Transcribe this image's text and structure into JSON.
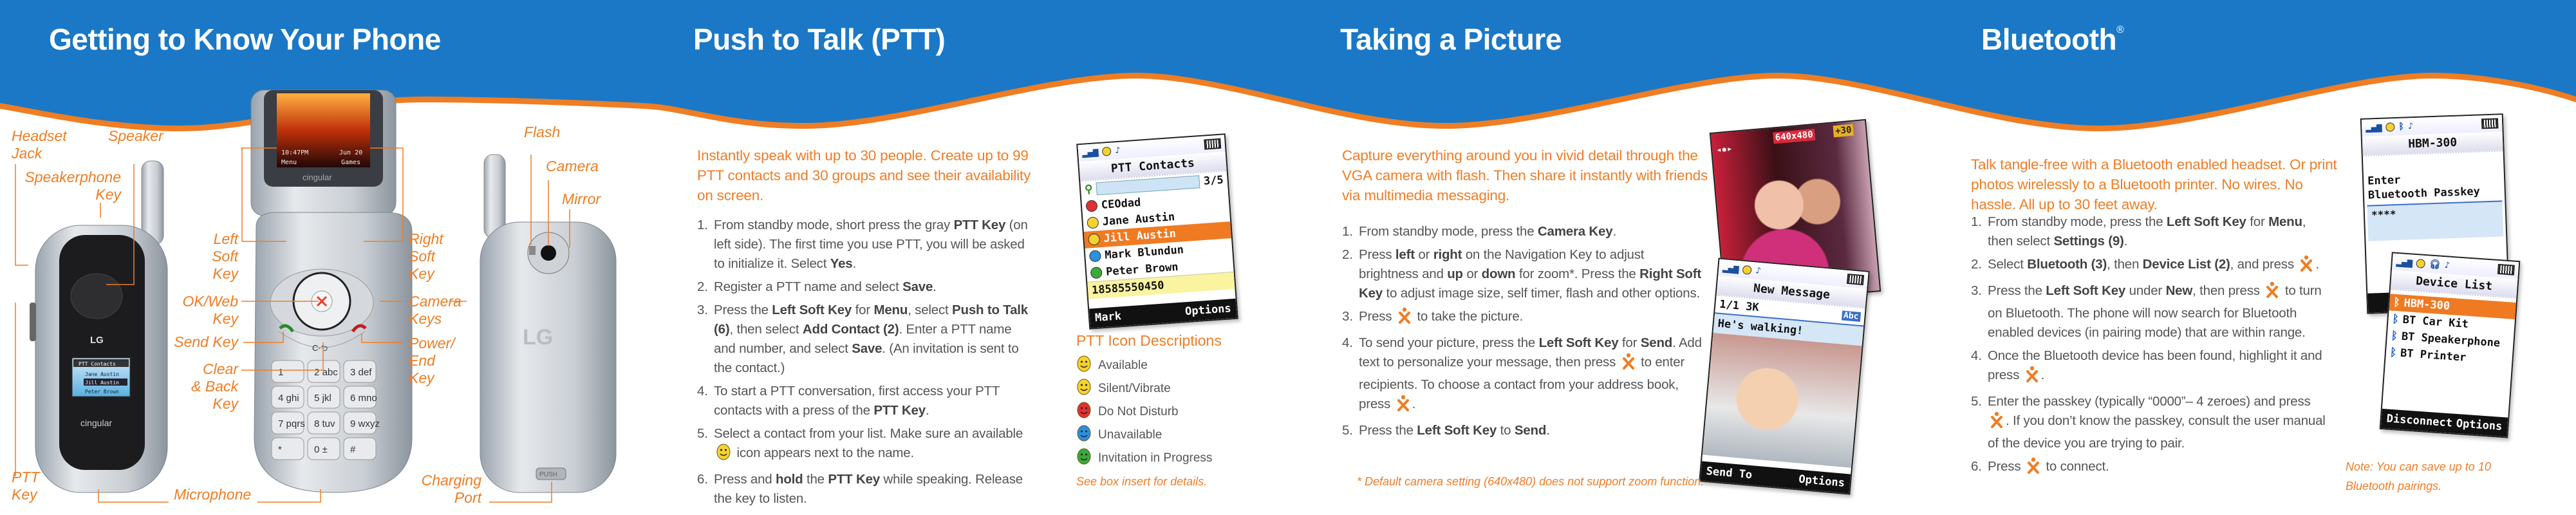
{
  "colors": {
    "header_blue": "#1a78c6",
    "accent_orange": "#ef7d23",
    "text_gray": "#555555"
  },
  "sections": {
    "phone": {
      "title": "Getting to Know Your Phone"
    },
    "ptt": {
      "title": "Push to Talk (PTT)"
    },
    "camera": {
      "title": "Taking a Picture"
    },
    "bluetooth": {
      "title": "Bluetooth",
      "title_mark": "®"
    }
  },
  "phone_labels": {
    "headset_jack": "Headset\nJack",
    "speaker": "Speaker",
    "speakerphone_key": "Speakerphone\nKey",
    "left_soft_key": "Left\nSoft\nKey",
    "ok_web_key": "OK/Web\nKey",
    "send_key": "Send Key",
    "clear_back_key": "Clear\n& Back\nKey",
    "ptt_key": "PTT\nKey",
    "microphone": "Microphone",
    "right_soft_key": "Right\nSoft\nKey",
    "camera_keys": "Camera\nKeys",
    "power_end_key": "Power/\nEnd\nKey",
    "flash": "Flash",
    "camera": "Camera",
    "mirror": "Mirror",
    "charging_port": "Charging\nPort"
  },
  "phone_images": {
    "brand": "cingular",
    "logo": "LG",
    "push_label": "PUSH",
    "open_screen": {
      "time": "10:47PM",
      "date": "Jun 20",
      "left_soft": "Menu",
      "right_soft": "Games"
    },
    "closed_screen": {
      "title": "PTT Contacts",
      "items": [
        "Jane Austin",
        "Jill Austin",
        "Peter Brown"
      ]
    },
    "keypad": [
      "1",
      "2 abc",
      "3 def",
      "4 ghi",
      "5 jkl",
      "6 mno",
      "7 pqrs",
      "8 tuv",
      "9 wxyz",
      "* ",
      "0 ±",
      "# "
    ]
  },
  "ptt": {
    "intro": "Instantly speak with up to 30 people. Create up to 99 PTT contacts and 30 groups and see their availability on screen.",
    "steps": [
      {
        "num": "1.",
        "segments": [
          {
            "t": "From standby mode, short press the gray "
          },
          {
            "t": "PTT Key",
            "b": true
          },
          {
            "t": " (on left side). The first time you use PTT, you will be asked to initialize it. Select "
          },
          {
            "t": "Yes",
            "b": true
          },
          {
            "t": "."
          }
        ]
      },
      {
        "num": "2.",
        "segments": [
          {
            "t": "Register a PTT name and select "
          },
          {
            "t": "Save",
            "b": true
          },
          {
            "t": "."
          }
        ]
      },
      {
        "num": "3.",
        "segments": [
          {
            "t": "Press the "
          },
          {
            "t": "Left Soft Key",
            "b": true
          },
          {
            "t": " for "
          },
          {
            "t": "Menu",
            "b": true
          },
          {
            "t": ", select "
          },
          {
            "t": "Push to Talk (6)",
            "b": true
          },
          {
            "t": ", then select "
          },
          {
            "t": "Add Contact (2)",
            "b": true
          },
          {
            "t": ". Enter a PTT name and number, and select "
          },
          {
            "t": "Save",
            "b": true
          },
          {
            "t": ". (An invitation is sent to the contact.)"
          }
        ]
      },
      {
        "num": "4.",
        "segments": [
          {
            "t": "To start a PTT conversation, first access your PTT contacts with a press of the "
          },
          {
            "t": "PTT Key",
            "b": true
          },
          {
            "t": "."
          }
        ]
      },
      {
        "num": "5.",
        "segments": [
          {
            "t": "Select a contact from your list. Make sure an available "
          },
          {
            "icon": "available-smiley-icon"
          },
          {
            "t": " icon appears next to the name."
          }
        ]
      },
      {
        "num": "6.",
        "segments": [
          {
            "t": "Press and "
          },
          {
            "t": "hold",
            "b": true
          },
          {
            "t": " the "
          },
          {
            "t": "PTT Key",
            "b": true
          },
          {
            "t": " while speaking. Release the key to listen."
          }
        ]
      }
    ],
    "screen": {
      "title": "PTT Contacts",
      "count": "3/5",
      "contacts": [
        {
          "name": "CEOdad",
          "status": "do-not-disturb"
        },
        {
          "name": "Jane Austin",
          "status": "silent-vibrate"
        },
        {
          "name": "Jill Austin",
          "status": "available",
          "selected": true
        },
        {
          "name": "Mark Blundun",
          "status": "unavailable"
        },
        {
          "name": "Peter Brown",
          "status": "invitation"
        }
      ],
      "number": "18585550450",
      "left_soft": "Mark",
      "right_soft": "Options"
    },
    "legend_title": "PTT Icon Descriptions",
    "legend": [
      {
        "label": "Available",
        "color": "#f5d22e",
        "icon": "available-smiley-icon"
      },
      {
        "label": "Silent/Vibrate",
        "color": "#f5d22e",
        "icon": "silent-vibrate-icon"
      },
      {
        "label": "Do Not Disturb",
        "color": "#e03030",
        "icon": "do-not-disturb-icon"
      },
      {
        "label": "Unavailable",
        "color": "#2a90e0",
        "icon": "unavailable-icon"
      },
      {
        "label": "Invitation in Progress",
        "color": "#3aaa3a",
        "icon": "invitation-icon"
      }
    ],
    "legend_note": "See box insert for details."
  },
  "camera": {
    "intro": "Capture everything around you in vivid detail through the VGA camera with flash. Then share it instantly with friends via multimedia messaging.",
    "steps": [
      {
        "num": "1.",
        "segments": [
          {
            "t": "From standby mode, press the "
          },
          {
            "t": "Camera Key",
            "b": true
          },
          {
            "t": "."
          }
        ]
      },
      {
        "num": "2.",
        "segments": [
          {
            "t": "Press "
          },
          {
            "t": "left",
            "b": true
          },
          {
            "t": " or "
          },
          {
            "t": "right",
            "b": true
          },
          {
            "t": " on the Navigation Key to adjust brightness and "
          },
          {
            "t": "up",
            "b": true
          },
          {
            "t": " or "
          },
          {
            "t": "down",
            "b": true
          },
          {
            "t": " for zoom*. Press the "
          },
          {
            "t": "Right Soft Key",
            "b": true
          },
          {
            "t": " to adjust image size, self timer, flash and other options."
          }
        ]
      },
      {
        "num": "3.",
        "segments": [
          {
            "t": "Press "
          },
          {
            "icon": "ok-key-icon"
          },
          {
            "t": " to take the picture."
          }
        ]
      },
      {
        "num": "4.",
        "segments": [
          {
            "t": "To send your picture, press the "
          },
          {
            "t": "Left Soft Key",
            "b": true
          },
          {
            "t": " for "
          },
          {
            "t": "Send",
            "b": true
          },
          {
            "t": ". Add text to personalize your message, then press "
          },
          {
            "icon": "ok-key-icon"
          },
          {
            "t": " to enter recipients. To choose a contact from your address book, press "
          },
          {
            "icon": "ok-key-icon"
          },
          {
            "t": "."
          }
        ]
      },
      {
        "num": "5.",
        "segments": [
          {
            "t": "Press the "
          },
          {
            "t": "Left Soft Key",
            "b": true
          },
          {
            "t": " to "
          },
          {
            "t": "Send",
            "b": true
          },
          {
            "t": "."
          }
        ]
      }
    ],
    "viewfinder": {
      "resolution": "640x480",
      "zoom_badge": "+30"
    },
    "message_screen": {
      "title": "New Message",
      "size": "1/1 3K",
      "mode": "Abc",
      "text": "He's walking!",
      "left_soft": "Send To",
      "right_soft": "Options"
    },
    "footnote": "* Default camera setting (640x480) does not support zoom function."
  },
  "bluetooth": {
    "intro": "Talk tangle-free with a Bluetooth enabled headset. Or print photos wirelessly to a Bluetooth printer. No wires. No hassle. All up to 30 feet away.",
    "steps": [
      {
        "num": "1.",
        "segments": [
          {
            "t": "From standby mode, press the "
          },
          {
            "t": "Left Soft Key",
            "b": true
          },
          {
            "t": " for "
          },
          {
            "t": "Menu",
            "b": true
          },
          {
            "t": ", then select "
          },
          {
            "t": "Settings (9)",
            "b": true
          },
          {
            "t": "."
          }
        ]
      },
      {
        "num": "2.",
        "segments": [
          {
            "t": "Select "
          },
          {
            "t": "Bluetooth (3)",
            "b": true
          },
          {
            "t": ", then "
          },
          {
            "t": "Device List (2)",
            "b": true
          },
          {
            "t": ", and press "
          },
          {
            "icon": "ok-key-icon"
          },
          {
            "t": "."
          }
        ]
      },
      {
        "num": "3.",
        "segments": [
          {
            "t": "Press the "
          },
          {
            "t": "Left Soft Key",
            "b": true
          },
          {
            "t": " under "
          },
          {
            "t": "New",
            "b": true
          },
          {
            "t": ", then press "
          },
          {
            "icon": "ok-key-icon"
          },
          {
            "t": " to turn on Bluetooth. The phone will now search for Bluetooth enabled devices (in pairing mode) that are within range."
          }
        ]
      },
      {
        "num": "4.",
        "segments": [
          {
            "t": "Once the Bluetooth device has been found, highlight it and press "
          },
          {
            "icon": "ok-key-icon"
          },
          {
            "t": "."
          }
        ]
      },
      {
        "num": "5.",
        "segments": [
          {
            "t": "Enter the passkey (typically “0000”– 4 zeroes) and press "
          },
          {
            "icon": "ok-key-icon"
          },
          {
            "t": ". If you don’t know the passkey, consult the user manual of the device you are trying to pair."
          }
        ]
      },
      {
        "num": "6.",
        "segments": [
          {
            "t": "Press "
          },
          {
            "icon": "ok-key-icon"
          },
          {
            "t": " to connect."
          }
        ]
      }
    ],
    "passkey_screen": {
      "title": "HBM-300",
      "prompt": "Enter\nBluetooth Passkey",
      "value": "****"
    },
    "device_screen": {
      "title": "Device List",
      "devices": [
        "HBM-300",
        "BT Car Kit",
        "BT Speakerphone",
        "BT Printer"
      ],
      "left_soft": "Disconnect",
      "right_soft": "Options"
    },
    "note": "Note: You can save up to 10 Bluetooth pairings."
  }
}
